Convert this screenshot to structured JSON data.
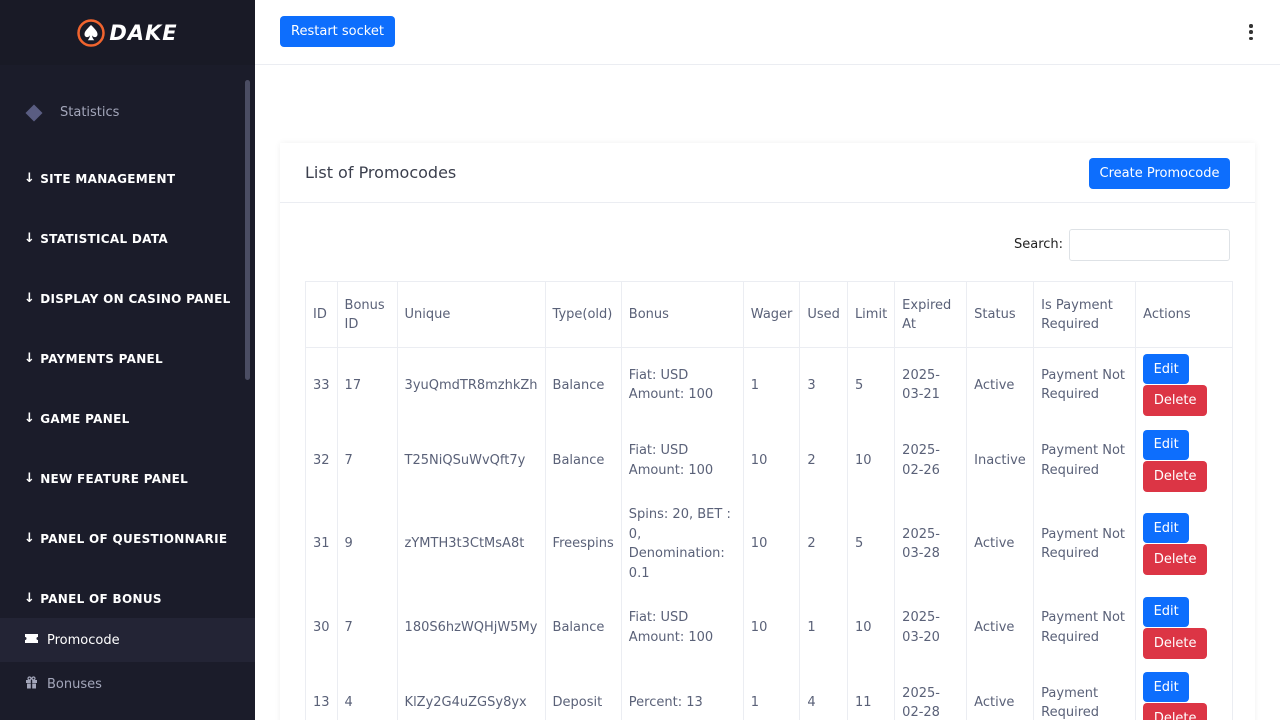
{
  "brand": {
    "name": "DAKE"
  },
  "sidebar": {
    "statistics_label": "Statistics",
    "sections": [
      "SITE MANAGEMENT",
      "STATISTICAL DATA",
      "DISPLAY ON CASINO PANEL",
      "PAYMENTS PANEL",
      "GAME PANEL",
      "NEW FEATURE PANEL",
      "PANEL OF QUESTIONNARIE",
      "PANEL OF BONUS"
    ],
    "items": [
      {
        "label": "Promocode",
        "icon": "ticket-icon",
        "active": true
      },
      {
        "label": "Bonuses",
        "icon": "gift-icon",
        "active": false
      }
    ]
  },
  "topbar": {
    "restart_label": "Restart socket",
    "menu_icon": "kebab-menu-icon"
  },
  "card": {
    "title": "List of Promocodes",
    "create_label": "Create Promocode",
    "search_label": "Search:",
    "search_value": ""
  },
  "table": {
    "headers": [
      "ID",
      "Bonus ID",
      "Unique",
      "Type(old)",
      "Bonus",
      "Wager",
      "Used",
      "Limit",
      "Expired At",
      "Status",
      "Is Payment Required",
      "Actions"
    ],
    "edit_label": "Edit",
    "delete_label": "Delete",
    "rows": [
      {
        "id": "33",
        "bonus_id": "17",
        "unique": "3yuQmdTR8mzhkZh",
        "type": "Balance",
        "bonus": "Fiat: USD Amount: 100",
        "wager": "1",
        "used": "3",
        "limit": "5",
        "expired": "2025-03-21",
        "status": "Active",
        "payment": "Payment Not Required"
      },
      {
        "id": "32",
        "bonus_id": "7",
        "unique": "T25NiQSuWvQft7y",
        "type": "Balance",
        "bonus": "Fiat: USD Amount: 100",
        "wager": "10",
        "used": "2",
        "limit": "10",
        "expired": "2025-02-26",
        "status": "Inactive",
        "payment": "Payment Not Required"
      },
      {
        "id": "31",
        "bonus_id": "9",
        "unique": "zYMTH3t3CtMsA8t",
        "type": "Freespins",
        "bonus": "Spins: 20, BET : 0, Denomination: 0.1",
        "wager": "10",
        "used": "2",
        "limit": "5",
        "expired": "2025-03-28",
        "status": "Active",
        "payment": "Payment Not Required"
      },
      {
        "id": "30",
        "bonus_id": "7",
        "unique": "180S6hzWQHjW5My",
        "type": "Balance",
        "bonus": "Fiat: USD Amount: 100",
        "wager": "10",
        "used": "1",
        "limit": "10",
        "expired": "2025-03-20",
        "status": "Active",
        "payment": "Payment Not Required"
      },
      {
        "id": "13",
        "bonus_id": "4",
        "unique": "KlZy2G4uZGSy8yx",
        "type": "Deposit",
        "bonus": "Percent: 13",
        "wager": "1",
        "used": "4",
        "limit": "11",
        "expired": "2025-02-28",
        "status": "Active",
        "payment": "Payment Required"
      }
    ]
  },
  "colors": {
    "primary": "#0d6efd",
    "danger": "#dc3545",
    "sidebar_bg": "#1b1c2a",
    "logo_accent": "#f0642e"
  }
}
